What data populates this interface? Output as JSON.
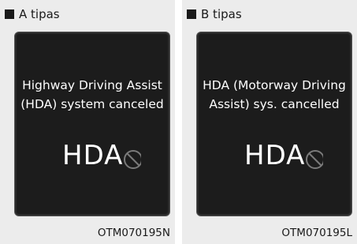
{
  "panels": [
    {
      "header": "A tipas",
      "message_lines": [
        "Highway Driving Assist",
        "(HDA) system canceled"
      ],
      "indicator_text": "HDA",
      "indicator_icon": "cancel-circle-icon",
      "code": "OTM070195N"
    },
    {
      "header": "B tipas",
      "message_lines": [
        "HDA (Motorway Driving",
        "Assist) sys. cancelled"
      ],
      "indicator_text": "HDA",
      "indicator_icon": "cancel-circle-icon",
      "code": "OTM070195L"
    }
  ],
  "colors": {
    "screen_bg": "#1c1c1c",
    "panel_bg": "#ececec",
    "text_on_screen": "#ffffff",
    "cancel_icon": "#7a7a7a"
  }
}
